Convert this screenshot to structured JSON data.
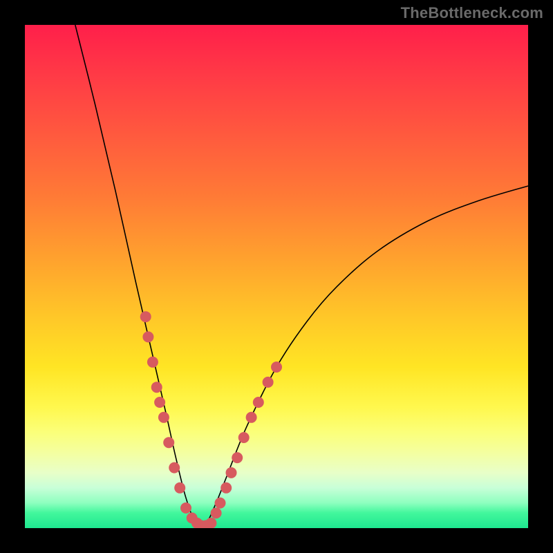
{
  "watermark": "TheBottleneck.com",
  "colors": {
    "frame": "#000000",
    "curve": "#000000",
    "dot": "#d75a5f",
    "gradient_top": "#ff1f4a",
    "gradient_bottom": "#1ee890"
  },
  "chart_data": {
    "type": "line",
    "title": "",
    "xlabel": "",
    "ylabel": "",
    "xlim": [
      0,
      100
    ],
    "ylim": [
      0,
      100
    ],
    "grid": false,
    "legend": false,
    "series": [
      {
        "name": "bottleneck-curve",
        "note": "V-shaped curve, minimum ≈0 around x≈34–37",
        "x": [
          10,
          14,
          18,
          22,
          25,
          28,
          30,
          32,
          34,
          36,
          38,
          40,
          44,
          50,
          56,
          62,
          70,
          80,
          90,
          100
        ],
        "y": [
          100,
          84,
          67,
          49,
          36,
          23,
          14,
          6,
          1,
          1,
          5,
          10,
          20,
          32,
          41,
          48,
          55,
          61,
          65,
          68
        ]
      }
    ],
    "highlight_points": {
      "name": "marked-dots",
      "note": "Clusters of emphasized points along the lower left and right arms of the V",
      "points": [
        {
          "x": 24.0,
          "y": 42
        },
        {
          "x": 24.5,
          "y": 38
        },
        {
          "x": 25.4,
          "y": 33
        },
        {
          "x": 26.2,
          "y": 28
        },
        {
          "x": 26.8,
          "y": 25
        },
        {
          "x": 27.6,
          "y": 22
        },
        {
          "x": 28.6,
          "y": 17
        },
        {
          "x": 29.7,
          "y": 12
        },
        {
          "x": 30.8,
          "y": 8
        },
        {
          "x": 32.0,
          "y": 4
        },
        {
          "x": 33.2,
          "y": 2
        },
        {
          "x": 34.2,
          "y": 1
        },
        {
          "x": 35.0,
          "y": 0.5
        },
        {
          "x": 36.0,
          "y": 0.5
        },
        {
          "x": 37.0,
          "y": 1
        },
        {
          "x": 38.0,
          "y": 3
        },
        {
          "x": 38.8,
          "y": 5
        },
        {
          "x": 40.0,
          "y": 8
        },
        {
          "x": 41.0,
          "y": 11
        },
        {
          "x": 42.2,
          "y": 14
        },
        {
          "x": 43.5,
          "y": 18
        },
        {
          "x": 45.0,
          "y": 22
        },
        {
          "x": 46.4,
          "y": 25
        },
        {
          "x": 48.3,
          "y": 29
        },
        {
          "x": 50.0,
          "y": 32
        }
      ]
    }
  }
}
